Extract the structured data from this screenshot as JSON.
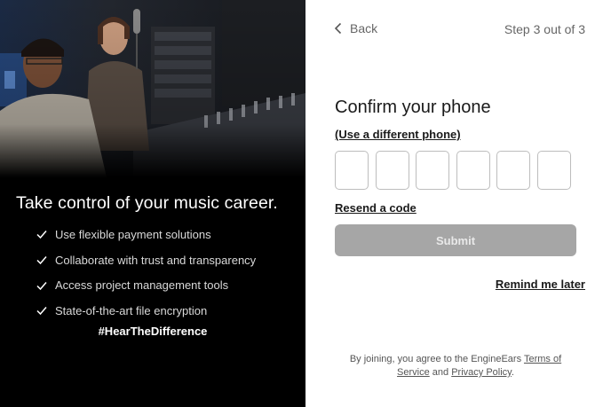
{
  "promo": {
    "tagline": "Take control of your music career.",
    "features": [
      "Use flexible payment solutions",
      "Collaborate with trust and transparency",
      "Access project management tools",
      "State-of-the-art file encryption"
    ],
    "hashtag": "#HearTheDifference"
  },
  "nav": {
    "back_label": "Back",
    "step_label": "Step 3 out of 3"
  },
  "form": {
    "title": "Confirm your phone",
    "different_phone_label": "(Use a different phone)",
    "code_digits": [
      "",
      "",
      "",
      "",
      "",
      ""
    ],
    "resend_label": "Resend a code",
    "submit_label": "Submit",
    "remind_label": "Remind me later"
  },
  "legal": {
    "prefix": "By joining, you agree to the EngineEars",
    "terms_label": "Terms of Service",
    "joiner": "and",
    "privacy_label": "Privacy Policy",
    "suffix": "."
  },
  "colors": {
    "left_background": "#000000",
    "submit_disabled": "#a6a6a6"
  },
  "icons": {
    "back": "chevron-left-icon",
    "feature_bullet": "check-icon"
  }
}
